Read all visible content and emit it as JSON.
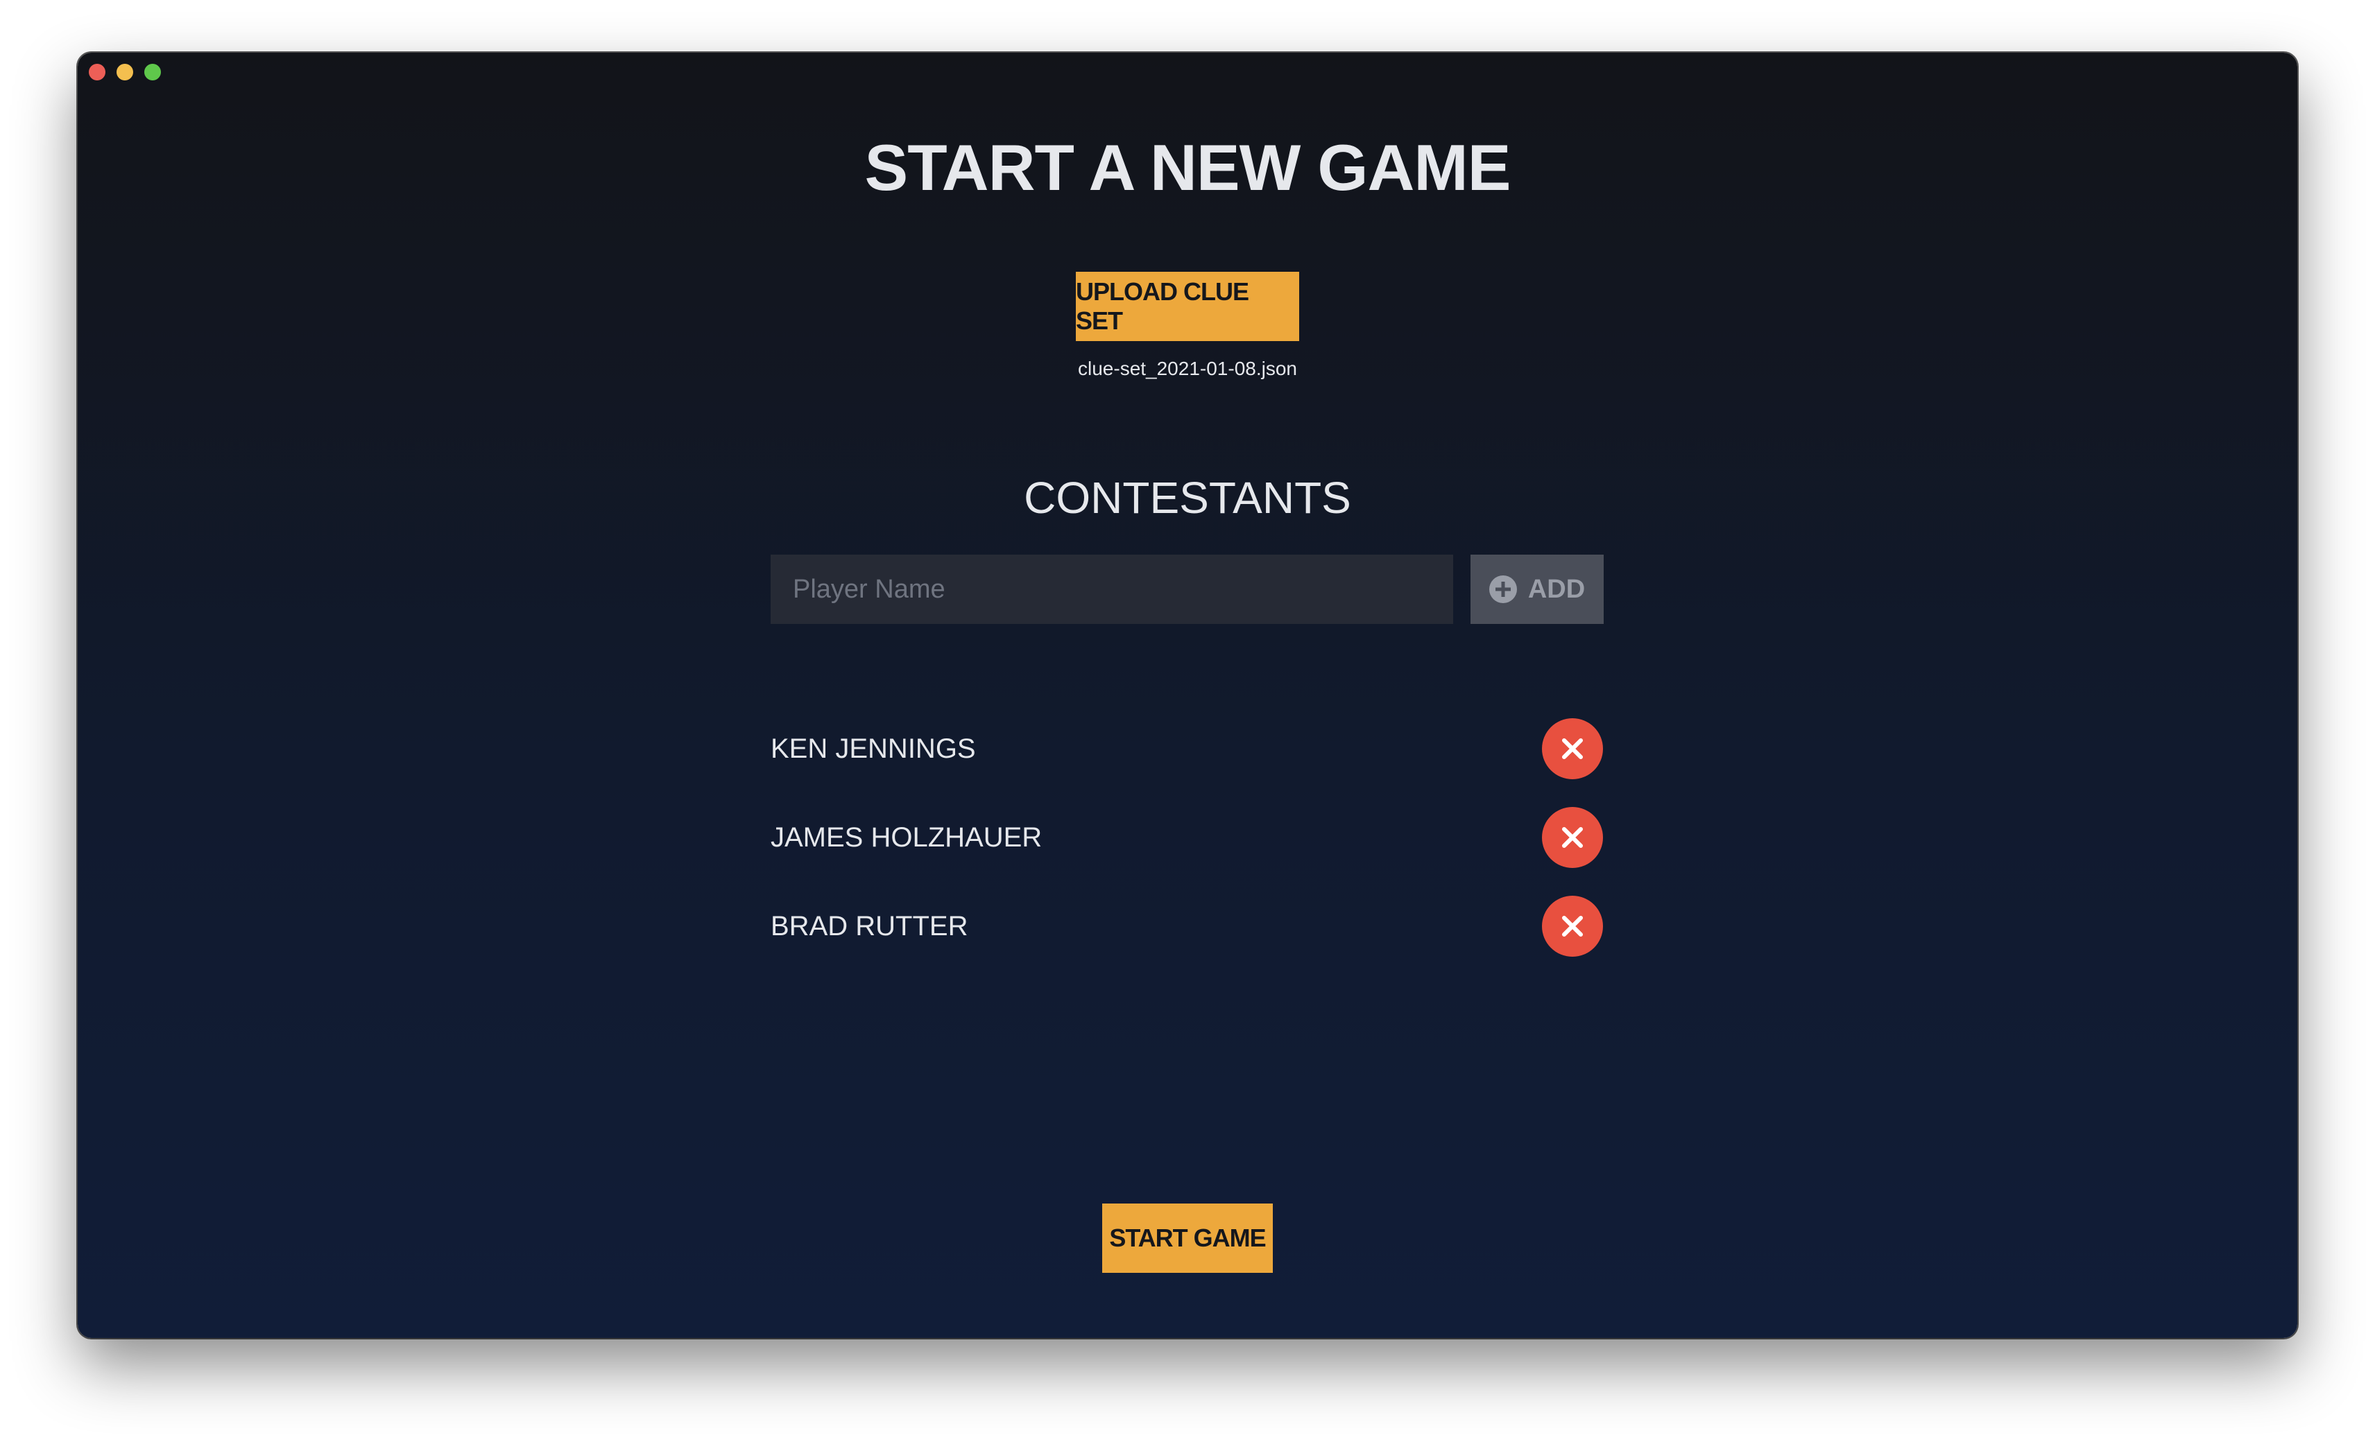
{
  "page": {
    "title": "START A NEW GAME"
  },
  "upload": {
    "button_label": "UPLOAD CLUE SET",
    "file_name": "clue-set_2021-01-08.json"
  },
  "contestants": {
    "section_title": "CONTESTANTS",
    "input_placeholder": "Player Name",
    "input_value": "",
    "add_label": "ADD",
    "add_icon": "plus-circle-icon",
    "remove_icon": "close-icon",
    "list": [
      {
        "name": "KEN JENNINGS"
      },
      {
        "name": "JAMES HOLZHAUER"
      },
      {
        "name": "BRAD RUTTER"
      }
    ]
  },
  "footer": {
    "start_label": "START GAME"
  },
  "colors": {
    "accent": "#eda83c",
    "remove": "#e8503f",
    "background_top": "#121419",
    "background_bottom": "#111d38",
    "text": "#e6e8ec"
  }
}
